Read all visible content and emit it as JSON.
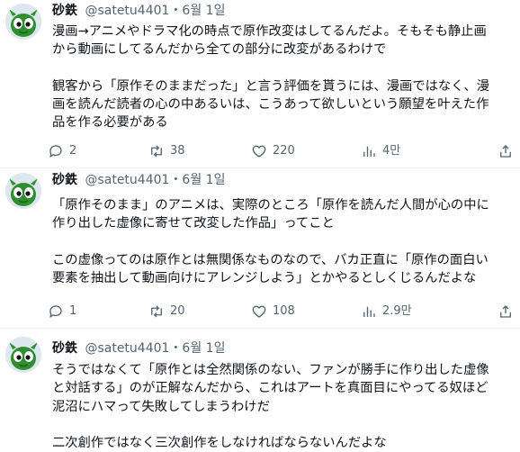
{
  "tweets": [
    {
      "author_name": "砂鉄",
      "handle": "@satetu4401",
      "separator": "・",
      "date": "6월 1일",
      "lines": [
        "漫画→アニメやドラマ化の時点で原作改変はしてるんだよ。そもそも静止画",
        "から動画にしてるんだから全ての部分に改変があるわけで",
        "",
        "観客から「原作そのままだった」と言う評価を貰うには、漫画ではなく、漫",
        "画を読んだ読者の心の中あるいは、こうあって欲しいという願望を叶えた作",
        "品を作る必要がある"
      ],
      "replies": "2",
      "reposts": "38",
      "likes": "220",
      "views": "4만"
    },
    {
      "author_name": "砂鉄",
      "handle": "@satetu4401",
      "separator": "・",
      "date": "6월 1일",
      "lines": [
        "「原作そのまま」のアニメは、実際のところ「原作を読んだ人間が心の中に",
        "作り出した虚像に寄せて改変した作品」ってこと",
        "",
        "この虚像ってのは原作とは無関係なものなので、バカ正直に「原作の面白い",
        "要素を抽出して動画向けにアレンジしよう」とかやるとしくじるんだよな"
      ],
      "replies": "1",
      "reposts": "20",
      "likes": "108",
      "views": "2.9만"
    },
    {
      "author_name": "砂鉄",
      "handle": "@satetu4401",
      "separator": "・",
      "date": "6월 1일",
      "lines": [
        "そうではなくて「原作とは全然関係のない、ファンが勝手に作り出した虚像",
        "と対話する」のが正解なんだから、これはアートを真面目にやってる奴ほど",
        "泥沼にハマって失敗してしまうわけだ",
        "",
        "二次創作ではなく三次創作をしなければならないんだよな"
      ]
    }
  ],
  "icons": {
    "reply": "reply-icon",
    "repost": "repost-icon",
    "like": "heart-icon",
    "views": "views-icon",
    "share": "share-icon",
    "avatar": "avatar-green-creature"
  },
  "colors": {
    "text": "#0f1419",
    "muted": "#536471",
    "divider": "#eff3f4",
    "avatar_green": "#2f8f2f"
  }
}
